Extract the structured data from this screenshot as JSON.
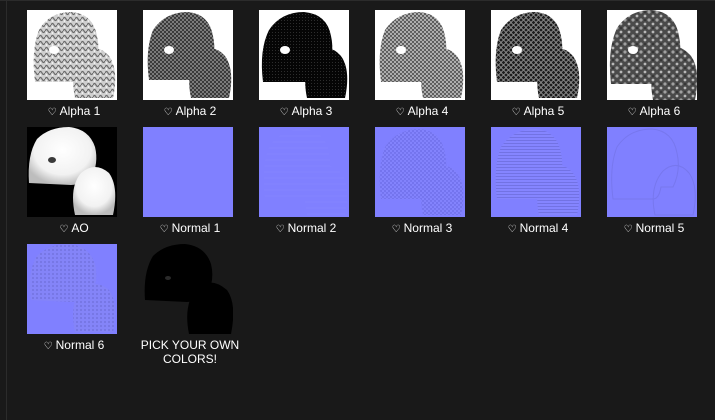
{
  "window": {
    "background": "#191919"
  },
  "items": [
    {
      "label": "Alpha 1",
      "favorite": true,
      "kind": "alpha1"
    },
    {
      "label": "Alpha 2",
      "favorite": true,
      "kind": "alpha2"
    },
    {
      "label": "Alpha 3",
      "favorite": true,
      "kind": "alpha3"
    },
    {
      "label": "Alpha 4",
      "favorite": true,
      "kind": "alpha4"
    },
    {
      "label": "Alpha 5",
      "favorite": true,
      "kind": "alpha5"
    },
    {
      "label": "Alpha 6",
      "favorite": true,
      "kind": "alpha6"
    },
    {
      "label": "AO",
      "favorite": true,
      "kind": "ao"
    },
    {
      "label": "Normal 1",
      "favorite": true,
      "kind": "normal"
    },
    {
      "label": "Normal 2",
      "favorite": true,
      "kind": "normal"
    },
    {
      "label": "Normal 3",
      "favorite": true,
      "kind": "normal-pattern"
    },
    {
      "label": "Normal 4",
      "favorite": true,
      "kind": "normal-pattern"
    },
    {
      "label": "Normal 5",
      "favorite": true,
      "kind": "normal-faint"
    },
    {
      "label": "Normal 6",
      "favorite": true,
      "kind": "normal-pattern"
    },
    {
      "label": "PICK YOUR OWN COLORS!",
      "favorite": false,
      "kind": "black"
    }
  ],
  "favorite_icon": "heart-outline-icon",
  "colors": {
    "normal_blue": "#8080ff",
    "alpha_white": "#ffffff",
    "alpha_black": "#000000"
  }
}
